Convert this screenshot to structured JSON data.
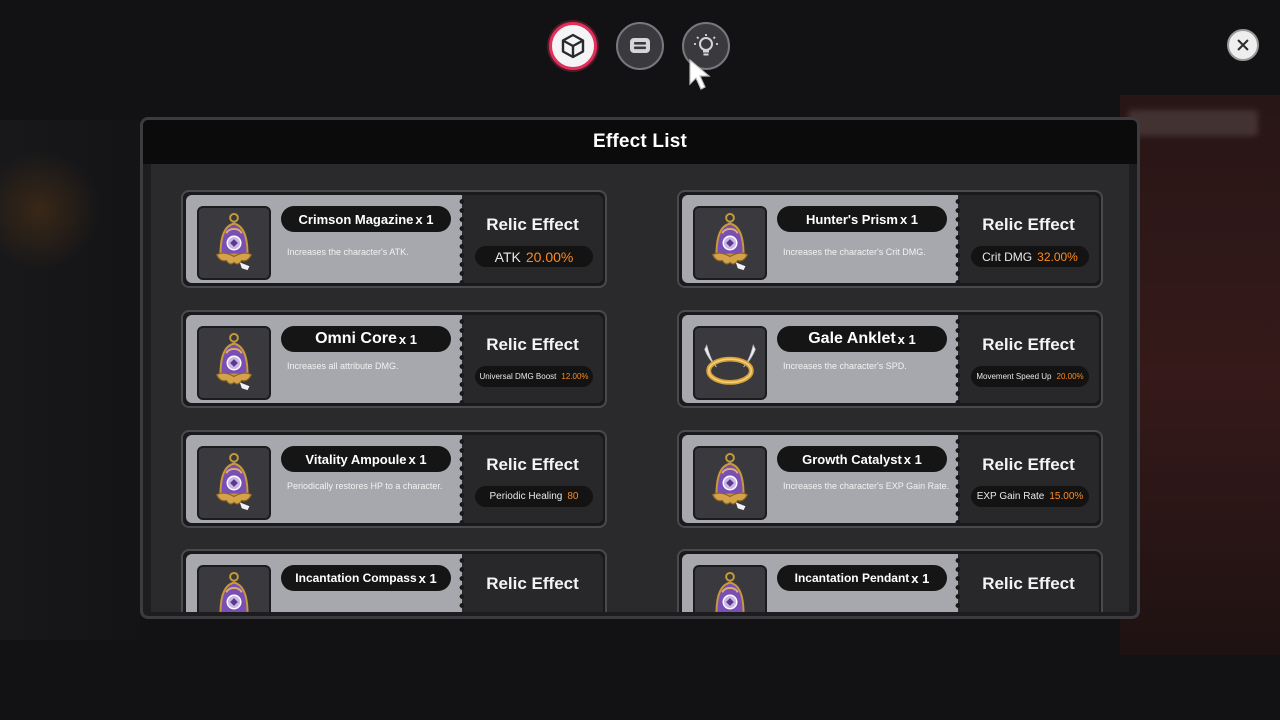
{
  "tabs": [
    {
      "name": "relic",
      "icon": "cube-icon",
      "active": true
    },
    {
      "name": "chat",
      "icon": "chat-icon",
      "active": false
    },
    {
      "name": "hint",
      "icon": "lightbulb-icon",
      "active": false
    }
  ],
  "panel": {
    "title": "Effect List",
    "relic_effect_label": "Relic Effect",
    "items": [
      {
        "name": "Crimson Magazine",
        "qty": "x 1",
        "desc": "Increases the character's ATK.",
        "stat": "ATK",
        "value": "20.00%",
        "icon": "bell-icon"
      },
      {
        "name": "Hunter's Prism",
        "qty": "x 1",
        "desc": "Increases the character's Crit DMG.",
        "stat": "Crit DMG",
        "value": "32.00%",
        "icon": "bell-icon"
      },
      {
        "name": "Omni Core",
        "qty": "x 1",
        "desc": "Increases all attribute DMG.",
        "stat": "Universal DMG Boost",
        "value": "12.00%",
        "icon": "bell-icon"
      },
      {
        "name": "Gale Anklet",
        "qty": "x 1",
        "desc": "Increases the character's SPD.",
        "stat": "Movement Speed Up",
        "value": "20.00%",
        "icon": "winged-ring-icon"
      },
      {
        "name": "Vitality Ampoule",
        "qty": "x 1",
        "desc": "Periodically restores HP to a character.",
        "stat": "Periodic Healing",
        "value": "80",
        "icon": "bell-icon"
      },
      {
        "name": "Growth Catalyst",
        "qty": "x 1",
        "desc": "Increases the character's EXP Gain Rate.",
        "stat": "EXP Gain Rate",
        "value": "15.00%",
        "icon": "bell-icon"
      },
      {
        "name": "Incantation Compass",
        "qty": "x 1",
        "desc": "",
        "stat": "",
        "value": "",
        "icon": "bell-icon"
      },
      {
        "name": "Incantation Pendant",
        "qty": "x 1",
        "desc": "",
        "stat": "",
        "value": "",
        "icon": "bell-icon"
      }
    ]
  },
  "colors": {
    "accent": "#e0305a",
    "stat_value": "#ff8a1f",
    "card_left": "#a6a8ad",
    "card_right": "#28282a"
  }
}
